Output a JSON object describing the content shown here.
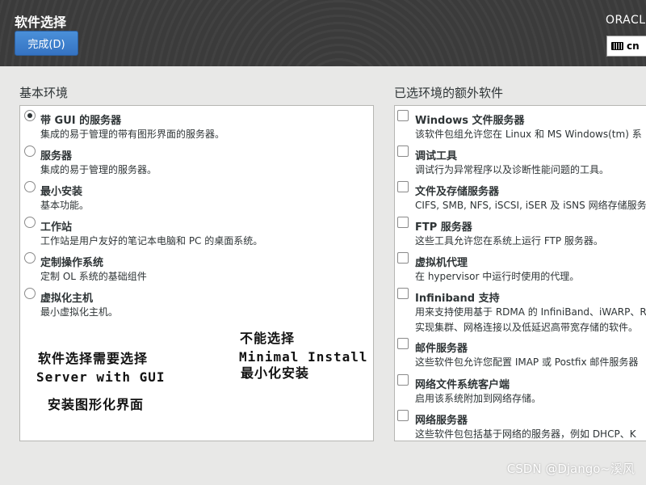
{
  "header": {
    "title": "软件选择",
    "done_label": "完成(D)",
    "brand": "ORACLE",
    "keyboard_layout": "cn"
  },
  "base_environment": {
    "heading": "基本环境",
    "items": [
      {
        "name": "带 GUI 的服务器",
        "desc": "集成的易于管理的带有图形界面的服务器。",
        "selected": true
      },
      {
        "name": "服务器",
        "desc": "集成的易于管理的服务器。",
        "selected": false
      },
      {
        "name": "最小安装",
        "desc": "基本功能。",
        "selected": false
      },
      {
        "name": "工作站",
        "desc": "工作站是用户友好的笔记本电脑和 PC 的桌面系统。",
        "selected": false
      },
      {
        "name": "定制操作系统",
        "desc": "定制 OL 系统的基础组件",
        "selected": false
      },
      {
        "name": "虚拟化主机",
        "desc": "最小虚拟化主机。",
        "selected": false
      }
    ]
  },
  "addons": {
    "heading": "已选环境的额外软件",
    "items": [
      {
        "name": "Windows 文件服务器",
        "desc": "该软件包组允许您在 Linux 和 MS Windows(tm) 系",
        "checked": false
      },
      {
        "name": "调试工具",
        "desc": "调试行为异常程序以及诊断性能问题的工具。",
        "checked": false
      },
      {
        "name": "文件及存储服务器",
        "desc": "CIFS, SMB, NFS, iSCSI, iSER 及 iSNS 网络存储服务",
        "checked": false
      },
      {
        "name": "FTP 服务器",
        "desc": "这些工具允许您在系统上运行 FTP 服务器。",
        "checked": false
      },
      {
        "name": "虚拟机代理",
        "desc": "在 hypervisor 中运行时使用的代理。",
        "checked": false
      },
      {
        "name": "Infiniband 支持",
        "desc": "用来支持使用基于 RDMA 的 InfiniBand、iWARP、R",
        "desc2": "实现集群、网格连接以及低延迟高带宽存储的软件。",
        "checked": false
      },
      {
        "name": "邮件服务器",
        "desc": "这些软件包允许您配置 IMAP 或 Postfix 邮件服务器",
        "checked": false
      },
      {
        "name": "网络文件系统客户端",
        "desc": "启用该系统附加到网络存储。",
        "checked": false
      },
      {
        "name": "网络服务器",
        "desc": "这些软件包包括基于网络的服务器，例如 DHCP、K",
        "checked": false
      }
    ]
  },
  "annotations": {
    "left_line1": "软件选择需要选择",
    "left_line2": "Server with GUI",
    "left_line3": "安装图形化界面",
    "right_line1": "不能选择",
    "right_line2": "Minimal Install",
    "right_line3": "最小化安装"
  },
  "watermark": "CSDN @Django~溪风"
}
